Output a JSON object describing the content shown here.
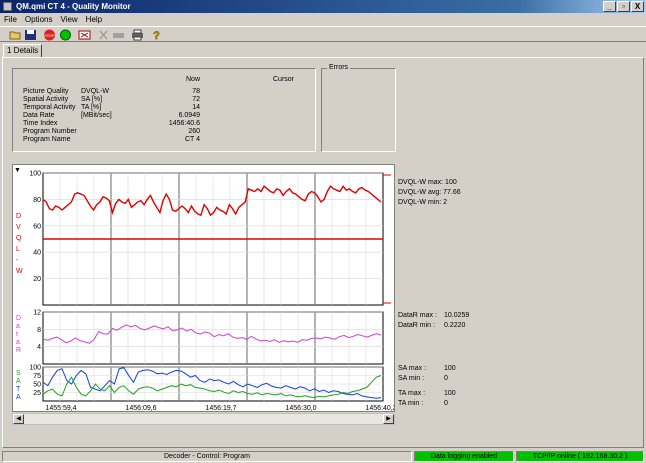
{
  "window": {
    "title": "QM.qmi CT 4 - Quality Monitor",
    "min_label": "_",
    "max_label": "▫",
    "close_label": "X"
  },
  "menu": [
    "File",
    "Options",
    "View",
    "Help"
  ],
  "toolbar": [
    "open-icon",
    "save-icon",
    "stop-icon",
    "record-icon",
    "export-icon",
    "cut-icon",
    "print-preview-icon",
    "print-icon",
    "help-icon"
  ],
  "tabs": [
    {
      "label": "1 Details"
    }
  ],
  "info": {
    "col_now": "Now",
    "col_cursor": "Cursor",
    "rows": [
      {
        "name": "Picture Quality",
        "unit": "DVQL-W",
        "now": "78"
      },
      {
        "name": "Spatial Activity",
        "unit": "SA [%]",
        "now": "72"
      },
      {
        "name": "Temporal Activity",
        "unit": "TA [%]",
        "now": "14"
      },
      {
        "name": "Data Rate",
        "unit": "[MBit/sec]",
        "now": "6.0949"
      },
      {
        "name": "Time Index",
        "unit": "",
        "now": "1456:40.6"
      },
      {
        "name": "Program Number",
        "unit": "",
        "now": "260"
      },
      {
        "name": "Program Name",
        "unit": "",
        "now": "CT 4"
      }
    ]
  },
  "errors": {
    "label": "Errors"
  },
  "chart_data": {
    "type": "line",
    "x_ticks": [
      "1455:59,4",
      "1456:09,6",
      "1456:19,7",
      "1456:30,0",
      "1456:40,2"
    ],
    "panels": [
      {
        "name": "DVQL-W",
        "axis_label": "DVQL-W",
        "ylim": [
          0,
          100
        ],
        "yticks": [
          "100",
          "80",
          "60",
          "40",
          "20"
        ],
        "series": [
          {
            "color": "#e00000",
            "values": [
              80,
              78,
              73,
              72,
              75,
              74,
              72,
              74,
              76,
              78,
              84,
              85,
              84,
              83,
              79,
              75,
              72,
              76,
              78,
              82,
              81,
              79,
              70,
              77,
              80,
              78,
              77,
              80,
              74,
              76,
              78,
              79,
              76,
              80,
              83,
              78,
              74,
              70,
              79,
              84,
              80,
              72,
              71,
              73,
              75,
              73,
              70,
              75,
              71,
              69,
              68,
              76,
              73,
              68,
              70,
              74,
              72,
              71,
              69,
              76,
              73,
              69,
              74,
              76,
              78,
              88,
              87,
              86,
              88,
              86,
              90,
              88,
              86,
              85,
              88,
              87,
              83,
              86,
              88,
              85,
              84,
              82,
              80,
              79,
              84,
              86,
              85,
              82,
              78,
              80,
              86,
              90,
              88,
              87,
              86,
              90,
              87,
              88,
              86,
              85,
              88,
              89,
              87,
              86,
              84,
              82,
              80,
              78
            ]
          }
        ],
        "threshold": 50
      },
      {
        "name": "DataR",
        "axis_label": "DataR",
        "ylim": [
          0,
          12
        ],
        "yticks": [
          "12",
          "8",
          "4"
        ],
        "series": [
          {
            "color": "#d040d0",
            "values": [
              5.8,
              5.5,
              5.9,
              6.2,
              5.6,
              4.9,
              5.3,
              6.0,
              5.4,
              5.1,
              4.8,
              5.6,
              7.5,
              7.0,
              6.9,
              8.2,
              7.8,
              8.5,
              9.0,
              8.6,
              8.9,
              8.2,
              7.9,
              8.3,
              8.8,
              8.4,
              8.1,
              8.6,
              7.7,
              7.9,
              8.3,
              7.6,
              8.0,
              7.2,
              6.9,
              7.4,
              7.1,
              6.3,
              6.8,
              6.5,
              7.0,
              6.2,
              5.9,
              6.1,
              5.7,
              6.4,
              5.8,
              5.3,
              5.5,
              5.2,
              5.6,
              5.0,
              5.4,
              5.1,
              5.3,
              5.0,
              5.6,
              5.5,
              5.9,
              6.0,
              5.8,
              6.2,
              6.0,
              5.7,
              6.3,
              6.6,
              6.1,
              6.4,
              6.8,
              6.5,
              6.2,
              6.6,
              7.0,
              6.7
            ]
          }
        ]
      },
      {
        "name": "SA/TA",
        "axis_label": "SA TA",
        "ylim": [
          0,
          100
        ],
        "yticks": [
          "100",
          "75",
          "50",
          "25"
        ],
        "series": [
          {
            "name": "SA",
            "color": "#1040e0",
            "values": [
              55,
              45,
              70,
              90,
              95,
              60,
              50,
              75,
              90,
              80,
              40,
              35,
              30,
              45,
              60,
              50,
              95,
              98,
              75,
              55,
              85,
              90,
              92,
              88,
              80,
              82,
              78,
              85,
              90,
              88,
              80,
              70,
              75,
              60,
              55,
              65,
              60,
              62,
              55,
              50,
              58,
              48,
              42,
              50,
              45,
              40,
              48,
              52,
              44,
              40,
              38,
              45,
              40,
              35,
              42,
              38,
              30,
              36,
              28,
              32,
              25,
              30,
              28,
              22,
              20,
              18,
              22,
              15,
              12,
              10,
              8,
              10
            ]
          },
          {
            "name": "TA",
            "color": "#20a020",
            "values": [
              20,
              30,
              35,
              20,
              15,
              50,
              70,
              40,
              20,
              15,
              30,
              50,
              35,
              30,
              45,
              25,
              40,
              45,
              30,
              20,
              35,
              40,
              42,
              38,
              30,
              35,
              40,
              45,
              42,
              50,
              45,
              48,
              40,
              38,
              35,
              30,
              28,
              32,
              26,
              22,
              30,
              25,
              28,
              22,
              20,
              24,
              18,
              22,
              20,
              18,
              22,
              15,
              18,
              14,
              12,
              16,
              12,
              10,
              14,
              12,
              15,
              18,
              20,
              25,
              22,
              28,
              30,
              35,
              40,
              55,
              70,
              75
            ]
          }
        ]
      }
    ]
  },
  "stats": {
    "dvql_max": "DVQL-W max: 100",
    "dvql_avg": "DVQL-W avg: 77.66",
    "dvql_min": "DVQL-W min:  2",
    "datar_max_label": "DataR max :",
    "datar_max": "10.0259",
    "datar_min_label": "DataR min :",
    "datar_min": "0.2220",
    "sa_max_label": "SA max :",
    "sa_max": "100",
    "sa_min_label": "SA min :",
    "sa_min": "0",
    "ta_max_label": "TA max :",
    "ta_max": "100",
    "ta_min_label": "TA min :",
    "ta_min": "0"
  },
  "status": {
    "control": "Decoder - Control: Program",
    "logging": "Data logging enabled",
    "tcp": "TCP/IP online ( 192.168.30.2 )",
    "green": "#00c000"
  }
}
